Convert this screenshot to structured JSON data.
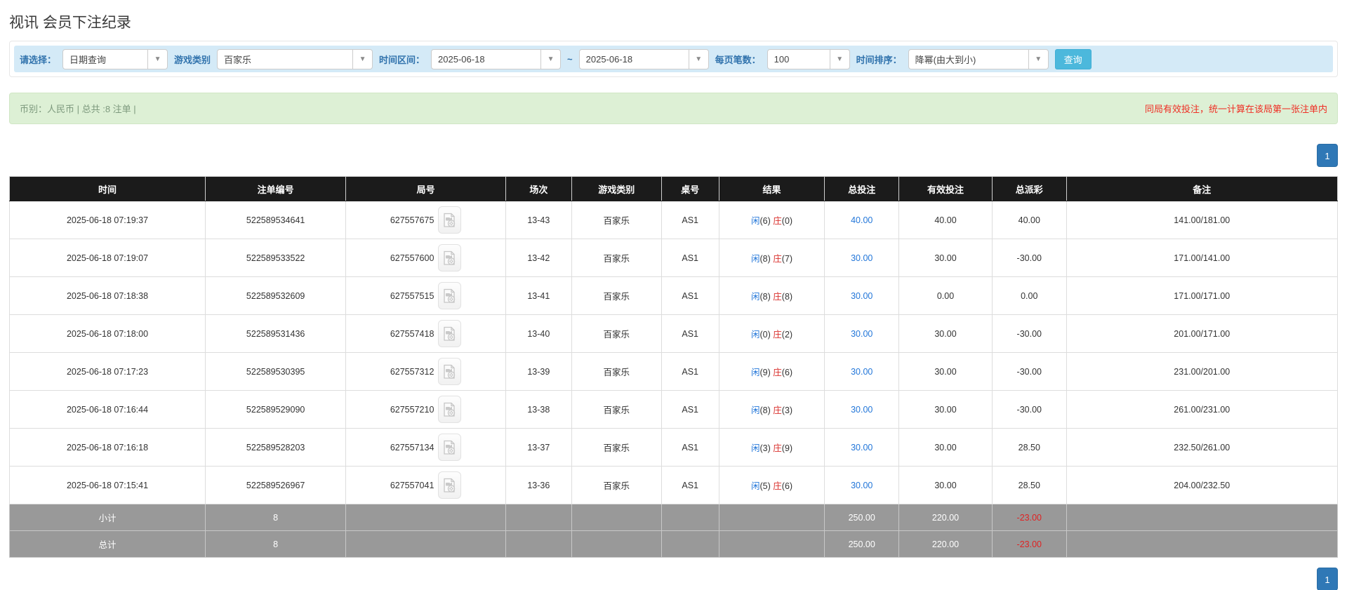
{
  "page": {
    "title": "视讯 会员下注纪录"
  },
  "filters": {
    "select_label": "请选择：",
    "select_value": "日期查询",
    "game_label": "游戏类别",
    "game_value": "百家乐",
    "range_label": "时间区间：",
    "date_from": "2025-06-18",
    "tilde": "~",
    "date_to": "2025-06-18",
    "page_size_label": "每页笔数：",
    "page_size_value": "100",
    "sort_label": "时间排序：",
    "sort_value": "降幂(由大到小)",
    "search_button": "查询",
    "caret_glyph": "▼"
  },
  "info_bar": {
    "left_text": "币别：人民币 | 总共 :8 注单 |",
    "right_text": "同局有效投注，统一计算在该局第一张注单内"
  },
  "pagination": {
    "current_page": "1"
  },
  "colors": {
    "header_bg": "#1b1b1b",
    "filter_bar_bg": "#d4eaf7",
    "info_bar_bg": "#ddf0d5",
    "accent_blue": "#2276d9",
    "banker_red": "#d9302c",
    "negative_red": "#e4312b",
    "search_button_bg": "#4cb8dc",
    "pagination_bg": "#2f78b6",
    "summary_bg": "#999999"
  },
  "table": {
    "headers": [
      "时间",
      "注单编号",
      "局号",
      "场次",
      "游戏类别",
      "桌号",
      "结果",
      "总投注",
      "有效投注",
      "总派彩",
      "备注"
    ],
    "rows": [
      {
        "time": "2025-06-18 07:19:37",
        "bet_id": "522589534641",
        "round_id": "627557675",
        "session": "13-43",
        "game": "百家乐",
        "table_no": "AS1",
        "player_char": "闲",
        "player_num": "(6)",
        "banker_char": "庄",
        "banker_num": "(0)",
        "total_bet": "40.00",
        "valid_bet": "40.00",
        "payout": "40.00",
        "note": "141.00/181.00"
      },
      {
        "time": "2025-06-18 07:19:07",
        "bet_id": "522589533522",
        "round_id": "627557600",
        "session": "13-42",
        "game": "百家乐",
        "table_no": "AS1",
        "player_char": "闲",
        "player_num": "(8)",
        "banker_char": "庄",
        "banker_num": "(7)",
        "total_bet": "30.00",
        "valid_bet": "30.00",
        "payout": "-30.00",
        "note": "171.00/141.00"
      },
      {
        "time": "2025-06-18 07:18:38",
        "bet_id": "522589532609",
        "round_id": "627557515",
        "session": "13-41",
        "game": "百家乐",
        "table_no": "AS1",
        "player_char": "闲",
        "player_num": "(8)",
        "banker_char": "庄",
        "banker_num": "(8)",
        "total_bet": "30.00",
        "valid_bet": "0.00",
        "payout": "0.00",
        "note": "171.00/171.00"
      },
      {
        "time": "2025-06-18 07:18:00",
        "bet_id": "522589531436",
        "round_id": "627557418",
        "session": "13-40",
        "game": "百家乐",
        "table_no": "AS1",
        "player_char": "闲",
        "player_num": "(0)",
        "banker_char": "庄",
        "banker_num": "(2)",
        "total_bet": "30.00",
        "valid_bet": "30.00",
        "payout": "-30.00",
        "note": "201.00/171.00"
      },
      {
        "time": "2025-06-18 07:17:23",
        "bet_id": "522589530395",
        "round_id": "627557312",
        "session": "13-39",
        "game": "百家乐",
        "table_no": "AS1",
        "player_char": "闲",
        "player_num": "(9)",
        "banker_char": "庄",
        "banker_num": "(6)",
        "total_bet": "30.00",
        "valid_bet": "30.00",
        "payout": "-30.00",
        "note": "231.00/201.00"
      },
      {
        "time": "2025-06-18 07:16:44",
        "bet_id": "522589529090",
        "round_id": "627557210",
        "session": "13-38",
        "game": "百家乐",
        "table_no": "AS1",
        "player_char": "闲",
        "player_num": "(8)",
        "banker_char": "庄",
        "banker_num": "(3)",
        "total_bet": "30.00",
        "valid_bet": "30.00",
        "payout": "-30.00",
        "note": "261.00/231.00"
      },
      {
        "time": "2025-06-18 07:16:18",
        "bet_id": "522589528203",
        "round_id": "627557134",
        "session": "13-37",
        "game": "百家乐",
        "table_no": "AS1",
        "player_char": "闲",
        "player_num": "(3)",
        "banker_char": "庄",
        "banker_num": "(9)",
        "total_bet": "30.00",
        "valid_bet": "30.00",
        "payout": "28.50",
        "note": "232.50/261.00"
      },
      {
        "time": "2025-06-18 07:15:41",
        "bet_id": "522589526967",
        "round_id": "627557041",
        "session": "13-36",
        "game": "百家乐",
        "table_no": "AS1",
        "player_char": "闲",
        "player_num": "(5)",
        "banker_char": "庄",
        "banker_num": "(6)",
        "total_bet": "30.00",
        "valid_bet": "30.00",
        "payout": "28.50",
        "note": "204.00/232.50"
      }
    ],
    "subtotal": {
      "label": "小计",
      "count": "8",
      "total_bet": "250.00",
      "valid_bet": "220.00",
      "payout": "-23.00"
    },
    "total": {
      "label": "总计",
      "count": "8",
      "total_bet": "250.00",
      "valid_bet": "220.00",
      "payout": "-23.00"
    }
  }
}
